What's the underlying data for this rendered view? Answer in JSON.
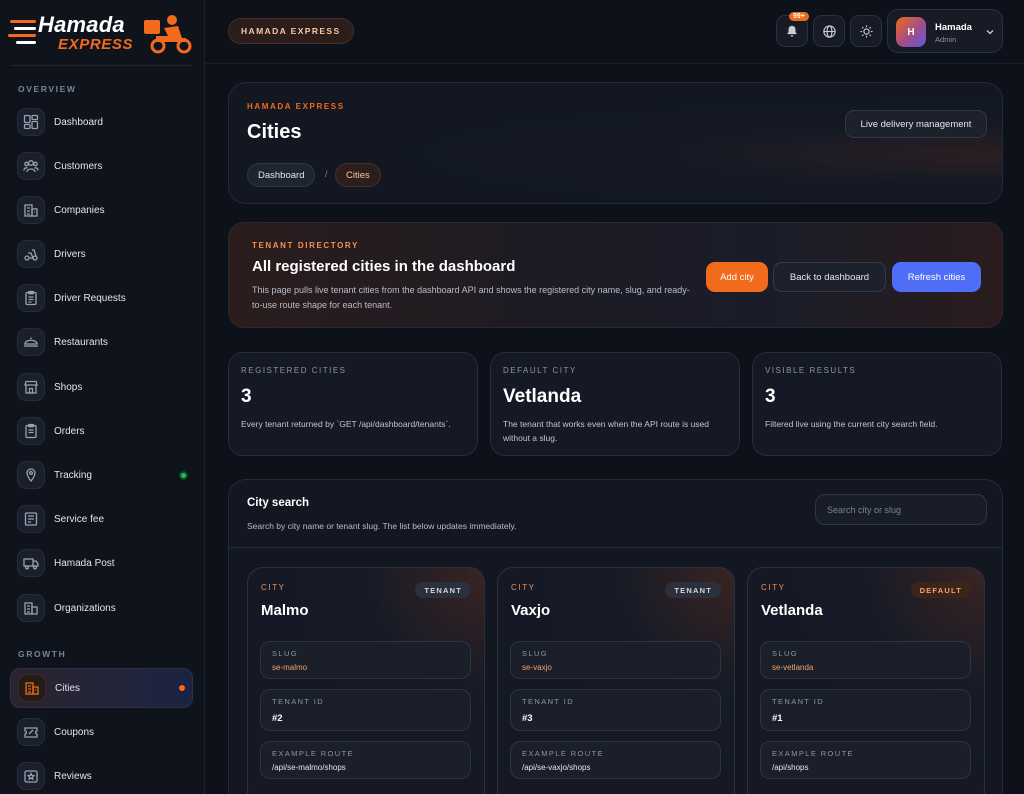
{
  "logo": {
    "top": "Hamada",
    "bottom": "EXPRESS"
  },
  "sidebar": {
    "sections": {
      "overview": "OVERVIEW",
      "growth": "GROWTH"
    },
    "items": [
      {
        "label": "Dashboard",
        "icon": "dashboard-icon"
      },
      {
        "label": "Customers",
        "icon": "customers-icon"
      },
      {
        "label": "Companies",
        "icon": "companies-icon"
      },
      {
        "label": "Drivers",
        "icon": "drivers-icon"
      },
      {
        "label": "Driver Requests",
        "icon": "clipboard-icon"
      },
      {
        "label": "Restaurants",
        "icon": "restaurant-icon"
      },
      {
        "label": "Shops",
        "icon": "shop-icon"
      },
      {
        "label": "Orders",
        "icon": "orders-icon"
      },
      {
        "label": "Tracking",
        "icon": "tracking-icon"
      },
      {
        "label": "Service fee",
        "icon": "service-fee-icon"
      },
      {
        "label": "Hamada Post",
        "icon": "truck-icon"
      },
      {
        "label": "Organizations",
        "icon": "organizations-icon"
      },
      {
        "label": "Cities",
        "icon": "cities-icon"
      },
      {
        "label": "Coupons",
        "icon": "coupon-icon"
      },
      {
        "label": "Reviews",
        "icon": "reviews-icon"
      }
    ]
  },
  "topbar": {
    "brand": "HAMADA EXPRESS",
    "notification_badge": "99+",
    "user": {
      "initial": "H",
      "name": "Hamada",
      "role": "Admin"
    }
  },
  "header": {
    "eyebrow": "HAMADA EXPRESS",
    "title": "Cities",
    "breadcrumb": [
      "Dashboard",
      "/",
      "Cities"
    ],
    "live_button": "Live delivery management"
  },
  "banner": {
    "eyebrow": "TENANT DIRECTORY",
    "title": "All registered cities in the dashboard",
    "description": "This page pulls live tenant cities from the dashboard API and shows the registered city name, slug, and ready-to-use route shape for each tenant.",
    "add_button": "Add city",
    "back_button": "Back to dashboard",
    "refresh_button": "Refresh cities"
  },
  "stats": [
    {
      "label": "REGISTERED CITIES",
      "value": "3",
      "description": "Every tenant returned by `GET /api/dashboard/tenants`."
    },
    {
      "label": "DEFAULT CITY",
      "value": "Vetlanda",
      "description": "The tenant that works even when the API route is used without a slug."
    },
    {
      "label": "VISIBLE RESULTS",
      "value": "3",
      "description": "Filtered live using the current city search field."
    }
  ],
  "search": {
    "title": "City search",
    "description": "Search by city name or tenant slug. The list below updates immediately.",
    "placeholder": "Search city or slug",
    "value": ""
  },
  "field_labels": {
    "city": "CITY",
    "slug": "SLUG",
    "tenant_id": "TENANT ID",
    "example_route": "EXAMPLE ROUTE"
  },
  "cities": [
    {
      "name": "Malmo",
      "tag": "TENANT",
      "slug": "se-malmo",
      "tenant_id": "#2",
      "route": "/api/se-malmo/shops"
    },
    {
      "name": "Vaxjo",
      "tag": "TENANT",
      "slug": "se-vaxjo",
      "tenant_id": "#3",
      "route": "/api/se-vaxjo/shops"
    },
    {
      "name": "Vetlanda",
      "tag": "DEFAULT",
      "slug": "se-vetlanda",
      "tenant_id": "#1",
      "route": "/api/shops"
    }
  ],
  "colors": {
    "accent": "#f26a1b",
    "primary_button": "#4f6ef7",
    "status_online": "#1fbf5a"
  }
}
